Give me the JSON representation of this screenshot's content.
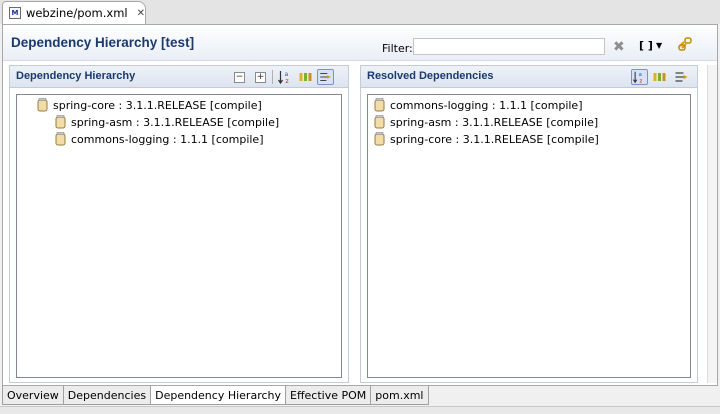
{
  "editor_tab": {
    "title": "webzine/pom.xml",
    "icon_text": "M"
  },
  "header": {
    "title": "Dependency Hierarchy [test]",
    "filter_label": "Filter:",
    "filter_value": "",
    "filter_placeholder": ""
  },
  "left_section": {
    "title": "Dependency Hierarchy",
    "tree": [
      {
        "label": "spring-core : 3.1.1.RELEASE [compile]",
        "level": 0
      },
      {
        "label": "spring-asm : 3.1.1.RELEASE [compile]",
        "level": 1
      },
      {
        "label": "commons-logging : 1.1.1 [compile]",
        "level": 1
      }
    ]
  },
  "right_section": {
    "title": "Resolved Dependencies",
    "list": [
      {
        "label": "commons-logging : 1.1.1 [compile]"
      },
      {
        "label": "spring-asm : 3.1.1.RELEASE [compile]"
      },
      {
        "label": "spring-core : 3.1.1.RELEASE [compile]"
      }
    ]
  },
  "bottom_tabs": [
    {
      "label": "Overview",
      "active": false
    },
    {
      "label": "Dependencies",
      "active": false
    },
    {
      "label": "Dependency Hierarchy",
      "active": true
    },
    {
      "label": "Effective POM",
      "active": false
    },
    {
      "label": "pom.xml",
      "active": false
    }
  ],
  "colors": {
    "title": "#1b3a6b",
    "section_header": "#dce4f0",
    "jar_icon": "#e8c890"
  }
}
